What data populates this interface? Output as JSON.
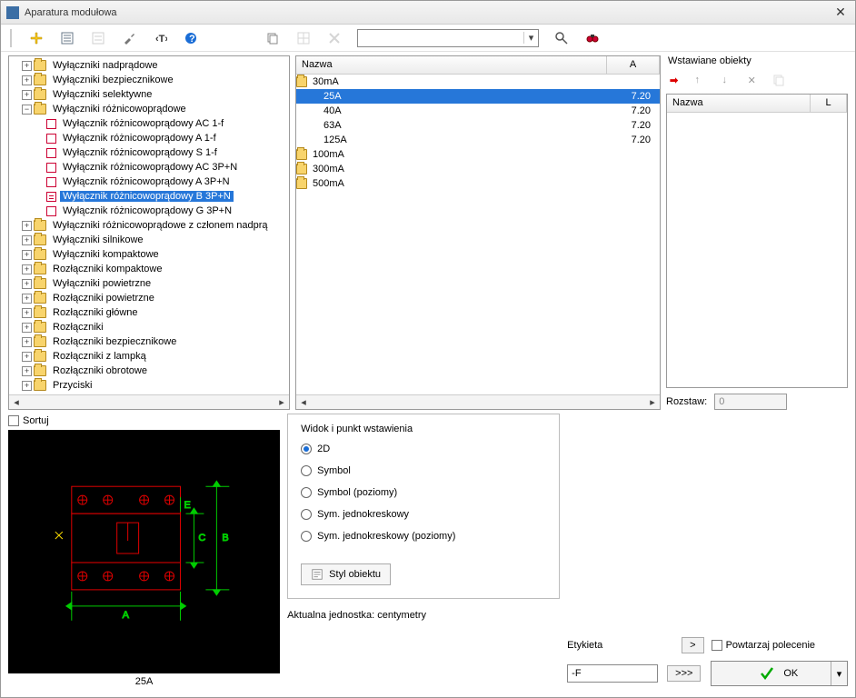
{
  "window": {
    "title": "Aparatura modułowa"
  },
  "tree": {
    "items": [
      {
        "pm": "+",
        "type": "folder",
        "label": "Wyłączniki nadprądowe",
        "depth": 0
      },
      {
        "pm": "+",
        "type": "folder",
        "label": "Wyłączniki bezpiecznikowe",
        "depth": 0
      },
      {
        "pm": "+",
        "type": "folder",
        "label": "Wyłączniki selektywne",
        "depth": 0
      },
      {
        "pm": "−",
        "type": "folder",
        "label": "Wyłączniki różnicowoprądowe",
        "depth": 0
      },
      {
        "pm": "",
        "type": "leaf",
        "label": "Wyłącznik różnicowoprądowy AC 1-f",
        "depth": 1
      },
      {
        "pm": "",
        "type": "leaf",
        "label": "Wyłącznik różnicowoprądowy A 1-f",
        "depth": 1
      },
      {
        "pm": "",
        "type": "leaf",
        "label": "Wyłącznik różnicowoprądowy S 1-f",
        "depth": 1
      },
      {
        "pm": "",
        "type": "leaf",
        "label": "Wyłącznik różnicowoprądowy AC 3P+N",
        "depth": 1
      },
      {
        "pm": "",
        "type": "leaf",
        "label": "Wyłącznik różnicowoprądowy A 3P+N",
        "depth": 1
      },
      {
        "pm": "",
        "type": "leaf",
        "label": "Wyłącznik różnicowoprądowy B 3P+N",
        "depth": 1,
        "selected": true
      },
      {
        "pm": "",
        "type": "leaf",
        "label": "Wyłącznik różnicowoprądowy G 3P+N",
        "depth": 1
      },
      {
        "pm": "+",
        "type": "folder",
        "label": "Wyłączniki różnicowoprądowe z członem nadprą",
        "depth": 0
      },
      {
        "pm": "+",
        "type": "folder",
        "label": "Wyłączniki silnikowe",
        "depth": 0
      },
      {
        "pm": "+",
        "type": "folder",
        "label": "Wyłączniki kompaktowe",
        "depth": 0
      },
      {
        "pm": "+",
        "type": "folder",
        "label": "Rozłączniki kompaktowe",
        "depth": 0
      },
      {
        "pm": "+",
        "type": "folder",
        "label": "Wyłączniki powietrzne",
        "depth": 0
      },
      {
        "pm": "+",
        "type": "folder",
        "label": "Rozłączniki powietrzne",
        "depth": 0
      },
      {
        "pm": "+",
        "type": "folder",
        "label": "Rozłączniki główne",
        "depth": 0
      },
      {
        "pm": "+",
        "type": "folder",
        "label": "Rozłączniki",
        "depth": 0
      },
      {
        "pm": "+",
        "type": "folder",
        "label": "Rozłączniki bezpiecznikowe",
        "depth": 0
      },
      {
        "pm": "+",
        "type": "folder",
        "label": "Rozłączniki z lampką",
        "depth": 0
      },
      {
        "pm": "+",
        "type": "folder",
        "label": "Rozłączniki obrotowe",
        "depth": 0
      },
      {
        "pm": "+",
        "type": "folder",
        "label": "Przyciski",
        "depth": 0
      }
    ]
  },
  "list": {
    "header_name": "Nazwa",
    "header_a": "A",
    "groups": [
      {
        "type": "folder",
        "name": "30mA",
        "rows": [
          {
            "name": "25A",
            "value": "7.20",
            "selected": true
          },
          {
            "name": "40A",
            "value": "7.20"
          },
          {
            "name": "63A",
            "value": "7.20"
          },
          {
            "name": "125A",
            "value": "7.20"
          }
        ]
      },
      {
        "type": "folder",
        "name": "100mA",
        "rows": []
      },
      {
        "type": "folder",
        "name": "300mA",
        "rows": []
      },
      {
        "type": "folder",
        "name": "500mA",
        "rows": []
      }
    ]
  },
  "right": {
    "title": "Wstawiane obiekty",
    "col_name": "Nazwa",
    "col_l": "L",
    "rozstaw_label": "Rozstaw:",
    "rozstaw_value": "0"
  },
  "preview": {
    "sort_label": "Sortuj",
    "caption": "25A"
  },
  "view": {
    "title": "Widok i punkt wstawienia",
    "opt_2d": "2D",
    "opt_symbol": "Symbol",
    "opt_symbol_h": "Symbol (poziomy)",
    "opt_sym1": "Sym. jednokreskowy",
    "opt_sym1h": "Sym. jednokreskowy (poziomy)",
    "style_btn": "Styl obiektu",
    "unit": "Aktualna jednostka: centymetry"
  },
  "etykieta": {
    "label": "Etykieta",
    "gt": ">",
    "value": "-F",
    "more": ">>>"
  },
  "ok": {
    "repeat": "Powtarzaj polecenie",
    "label": "OK"
  }
}
